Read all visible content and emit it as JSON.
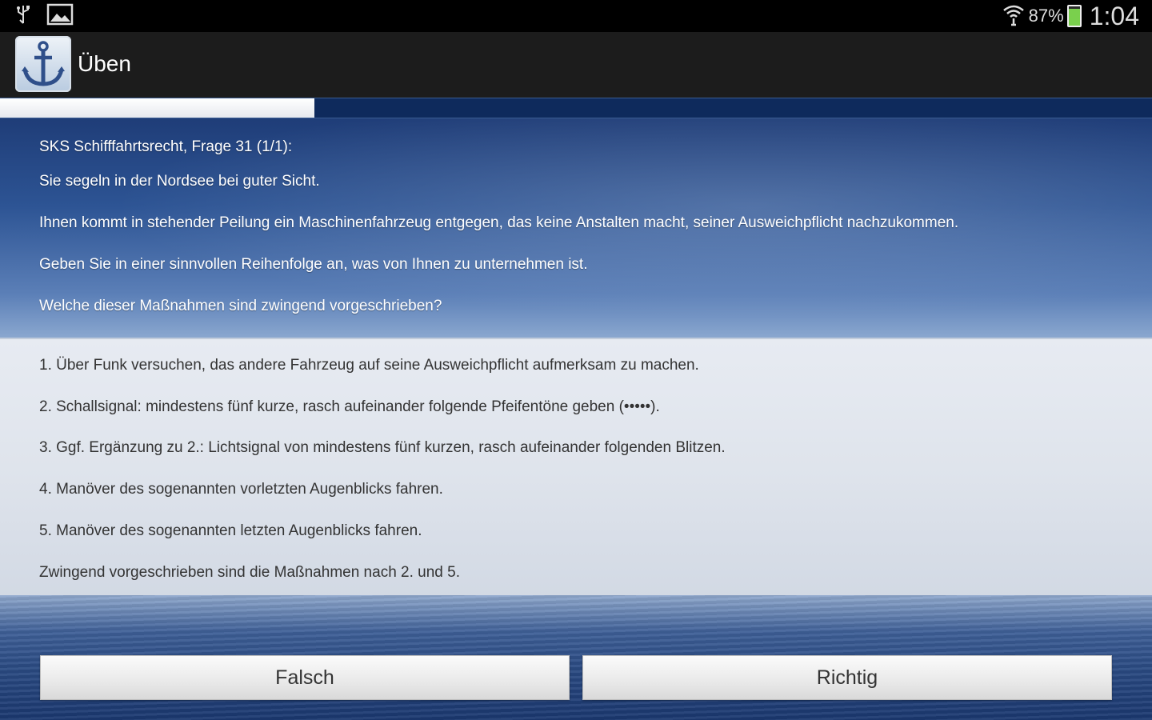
{
  "status_bar": {
    "battery_percent": "87%",
    "time": "1:04",
    "icons": [
      "usb-icon",
      "image-icon",
      "wifi-icon",
      "battery-icon"
    ]
  },
  "action_bar": {
    "title": "Üben",
    "app_icon": "anchor-icon"
  },
  "progress": {
    "fraction": 0.273
  },
  "question": {
    "header": "SKS Schifffahrtsrecht, Frage 31 (1/1):",
    "lines": [
      "Sie segeln in der Nordsee bei guter Sicht.",
      "Ihnen kommt in stehender Peilung ein Maschinenfahrzeug entgegen, das keine Anstalten macht, seiner Ausweichpflicht nachzukommen.",
      "Geben Sie in einer sinnvollen Reihenfolge an, was von Ihnen zu unternehmen ist.",
      "Welche dieser Maßnahmen sind zwingend vorgeschrieben?"
    ]
  },
  "answer": {
    "lines": [
      "1. Über Funk versuchen, das andere Fahrzeug auf seine Ausweichpflicht aufmerksam zu machen.",
      "2. Schallsignal: mindestens fünf kurze, rasch aufeinander folgende Pfeifentöne geben (•••••).",
      "3. Ggf. Ergänzung zu 2.: Lichtsignal von mindestens fünf kurzen, rasch aufeinander folgenden Blitzen.",
      "4. Manöver des sogenannten vorletzten Augenblicks fahren.",
      "5. Manöver des sogenannten letzten Augenblicks fahren.",
      "Zwingend vorgeschrieben sind die Maßnahmen nach 2. und 5."
    ]
  },
  "buttons": {
    "wrong_label": "Falsch",
    "right_label": "Richtig"
  }
}
